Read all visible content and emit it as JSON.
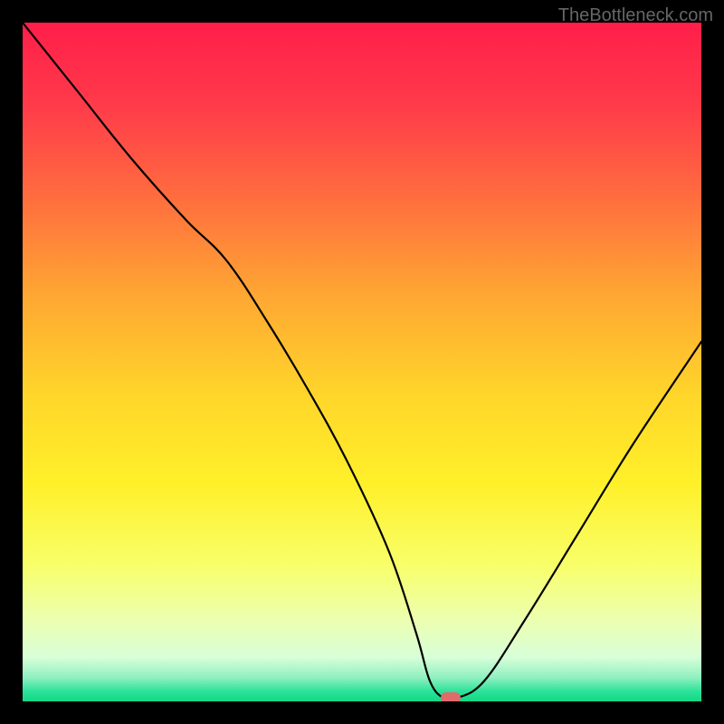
{
  "watermark": "TheBottleneck.com",
  "chart_data": {
    "type": "line",
    "title": "",
    "xlabel": "",
    "ylabel": "",
    "xlim": [
      0,
      100
    ],
    "ylim": [
      0,
      100
    ],
    "series": [
      {
        "name": "bottleneck-curve",
        "x": [
          0,
          8,
          16,
          24,
          30,
          36,
          42,
          48,
          54,
          58,
          60,
          62,
          64,
          68,
          74,
          82,
          90,
          100
        ],
        "y": [
          100,
          90,
          80,
          71,
          65,
          56,
          46,
          35,
          22,
          10,
          3,
          0.5,
          0.5,
          3,
          12,
          25,
          38,
          53
        ]
      }
    ],
    "marker": {
      "x": 63,
      "y": 0.5,
      "color": "#e16a6a"
    },
    "gradient_stops": [
      {
        "pos": 0.0,
        "color": "#ff1e4a"
      },
      {
        "pos": 0.12,
        "color": "#ff3a4a"
      },
      {
        "pos": 0.25,
        "color": "#ff6a3f"
      },
      {
        "pos": 0.4,
        "color": "#ffa633"
      },
      {
        "pos": 0.55,
        "color": "#ffd62a"
      },
      {
        "pos": 0.68,
        "color": "#fff02a"
      },
      {
        "pos": 0.8,
        "color": "#f8ff6a"
      },
      {
        "pos": 0.88,
        "color": "#ecffb0"
      },
      {
        "pos": 0.935,
        "color": "#d8ffd8"
      },
      {
        "pos": 0.965,
        "color": "#8ff0c0"
      },
      {
        "pos": 0.985,
        "color": "#2de29a"
      },
      {
        "pos": 1.0,
        "color": "#10d885"
      }
    ]
  }
}
